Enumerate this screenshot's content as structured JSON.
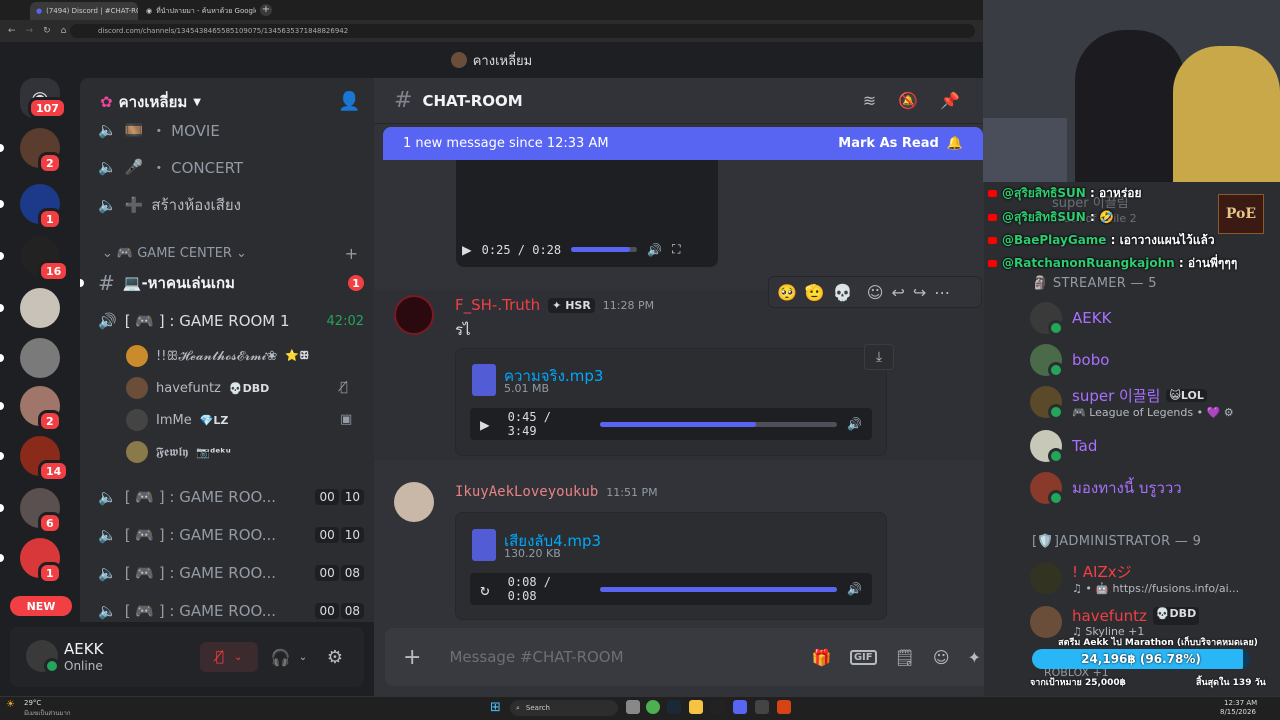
{
  "browser": {
    "tabs": [
      {
        "label": "(7494) Discord | #CHAT-RO"
      },
      {
        "label": "ที่นำปลายมา - ค้นหาด้วย Google"
      }
    ],
    "url": "discord.com/channels/1345438465585109075/1345635371848826942"
  },
  "window_title": "คางเหลี่ยม",
  "rail": {
    "home_badge": "107",
    "servers": [
      {
        "badge": "2",
        "color": "#5a3d2e"
      },
      {
        "badge": "1",
        "color": "#1d3a8a"
      },
      {
        "badge": "16",
        "color": "#222"
      },
      {
        "badge": "",
        "color": "#c9c2b8"
      },
      {
        "badge": "",
        "color": "#7a7a7a"
      },
      {
        "badge": "2",
        "color": "#a0766a"
      },
      {
        "badge": "14",
        "color": "#8a2a1a"
      },
      {
        "badge": "6",
        "color": "#5a5050"
      },
      {
        "badge": "1",
        "color": "#d9383a"
      }
    ],
    "new_label": "NEW"
  },
  "guild": {
    "name": "คางเหลี่ยม",
    "channels": [
      {
        "icon": "🎞️",
        "label": "・ MOVIE"
      },
      {
        "icon": "🎤",
        "label": "・ CONCERT"
      },
      {
        "icon": "➕",
        "label": "สร้างห้องเสียง"
      }
    ],
    "category": "🎮 GAME CENTER",
    "text_channel": {
      "label": "💻-หาคนเล่นเกม",
      "badge": "1"
    },
    "active_voice": {
      "label": "[ 🎮 ] : GAME ROOM 1",
      "timer": "42:02"
    },
    "voice_users": [
      {
        "name": "!!ꕥ𝓗𝓮𝓪𝓷𝓽𝓱𝓸𝓼𝓔𝓻𝓶𝓲❀",
        "tag": "⭐ꕥ",
        "color": "#c98b2c"
      },
      {
        "name": "havefuntz",
        "tag": "💀DBD",
        "color": "#6b4e3a"
      },
      {
        "name": "ImMe",
        "tag": "💎LZ",
        "color": "#444"
      },
      {
        "name": "𝕱𝖊𝖜𝖑𝖞",
        "tag": "📷ᵈᵉᵏᵘ",
        "color": "#8a7a4a"
      }
    ],
    "game_rooms": [
      {
        "label": "[ 🎮 ] : GAME ROO...",
        "c1": "00",
        "c2": "10"
      },
      {
        "label": "[ 🎮 ] : GAME ROO...",
        "c1": "00",
        "c2": "10"
      },
      {
        "label": "[ 🎮 ] : GAME ROO...",
        "c1": "00",
        "c2": "08"
      },
      {
        "label": "[ 🎮 ] : GAME ROO...",
        "c1": "00",
        "c2": "08"
      }
    ]
  },
  "user": {
    "name": "AEKK",
    "status": "Online"
  },
  "chat": {
    "channel": "CHAT-ROOM",
    "new_bar": {
      "text": "1 new message since 12:33 AM",
      "action": "Mark As Read"
    },
    "video_player": {
      "time": "0:25 / 0:28",
      "progress": 0.89
    },
    "reactions": [
      "🥺",
      "🫡",
      "💀"
    ],
    "messages": [
      {
        "author": "F_SH-.Truth",
        "tag": "HSR",
        "time": "11:28 PM",
        "text": "รไ",
        "color": "#f23f43",
        "file": {
          "name": "ความจริง.mp3",
          "size": "5.01 MB",
          "time": "0:45 / 3:49",
          "progress": 0.66
        }
      },
      {
        "author": "IkuyAekLoveyoukub",
        "time": "11:51 PM",
        "color": "#e78284",
        "file": {
          "name": "เสียงลับ4.mp3",
          "size": "130.20 KB",
          "time": "0:08 / 0:08",
          "progress": 1.0
        }
      }
    ],
    "composer_placeholder": "Message #CHAT-ROOM"
  },
  "yt_chat": [
    {
      "name": "@สุริยสิทธิSUN",
      "text": ": อาหร่อย"
    },
    {
      "name": "@สุริยสิทธิSUN",
      "text": ": 🤣"
    },
    {
      "name": "@BaePlayGame",
      "text": ": เอาวางแผนไว้แล้ว"
    },
    {
      "name": "@RatchanonRuangkajohn",
      "text": ": อ่านพี่ๆๆๆ"
    }
  ],
  "members": {
    "faded_lines": [
      "super 이끌림",
      "Path of Exile 2"
    ],
    "streamer_header": "STREAMER — 5",
    "streamers": [
      {
        "name": "AEKK",
        "sub": "",
        "color": "#3a3a3a"
      },
      {
        "name": "bobo",
        "sub": "",
        "color": "#4a6a4a"
      },
      {
        "name": "super 이끌림",
        "tag": "😺LOL",
        "sub": "🎮 League of Legends • 💜 ⚙",
        "color": "#5a4a2a"
      },
      {
        "name": "Tad",
        "sub": "",
        "color": "#c8c8b8"
      },
      {
        "name": "มองทางนี้ บรูววว",
        "sub": "",
        "color": "#8a3a2a"
      }
    ],
    "admin_header": "[🛡️]ADMINISTRATOR — 9",
    "admins": [
      {
        "name": "! AIZxジ",
        "sub": "♫ • 🤖 https://fusions.info/ai...",
        "color": "#332"
      },
      {
        "name": "havefuntz",
        "tag": "💀DBD",
        "sub": "♫ Skyline +1",
        "color": "#6b4e3a"
      }
    ]
  },
  "stream_overlay": {
    "title": "สตรีม Aekk ไป Marathon (เก็บบริจาคหมดเลย)",
    "amount": "24,196฿ (96.78%)",
    "progress": 0.9678,
    "goal": "จากเป้าหมาย 25,000฿",
    "days": "สิ้นสุดใน 139 วัน",
    "roblox": "ROBLOX +1"
  },
  "taskbar": {
    "weather": "29°C",
    "weather_sub": "มีเมฆเป็นส่วนมาก",
    "search": "Search",
    "time": "12:37 AM",
    "date": "8/15/2026"
  }
}
